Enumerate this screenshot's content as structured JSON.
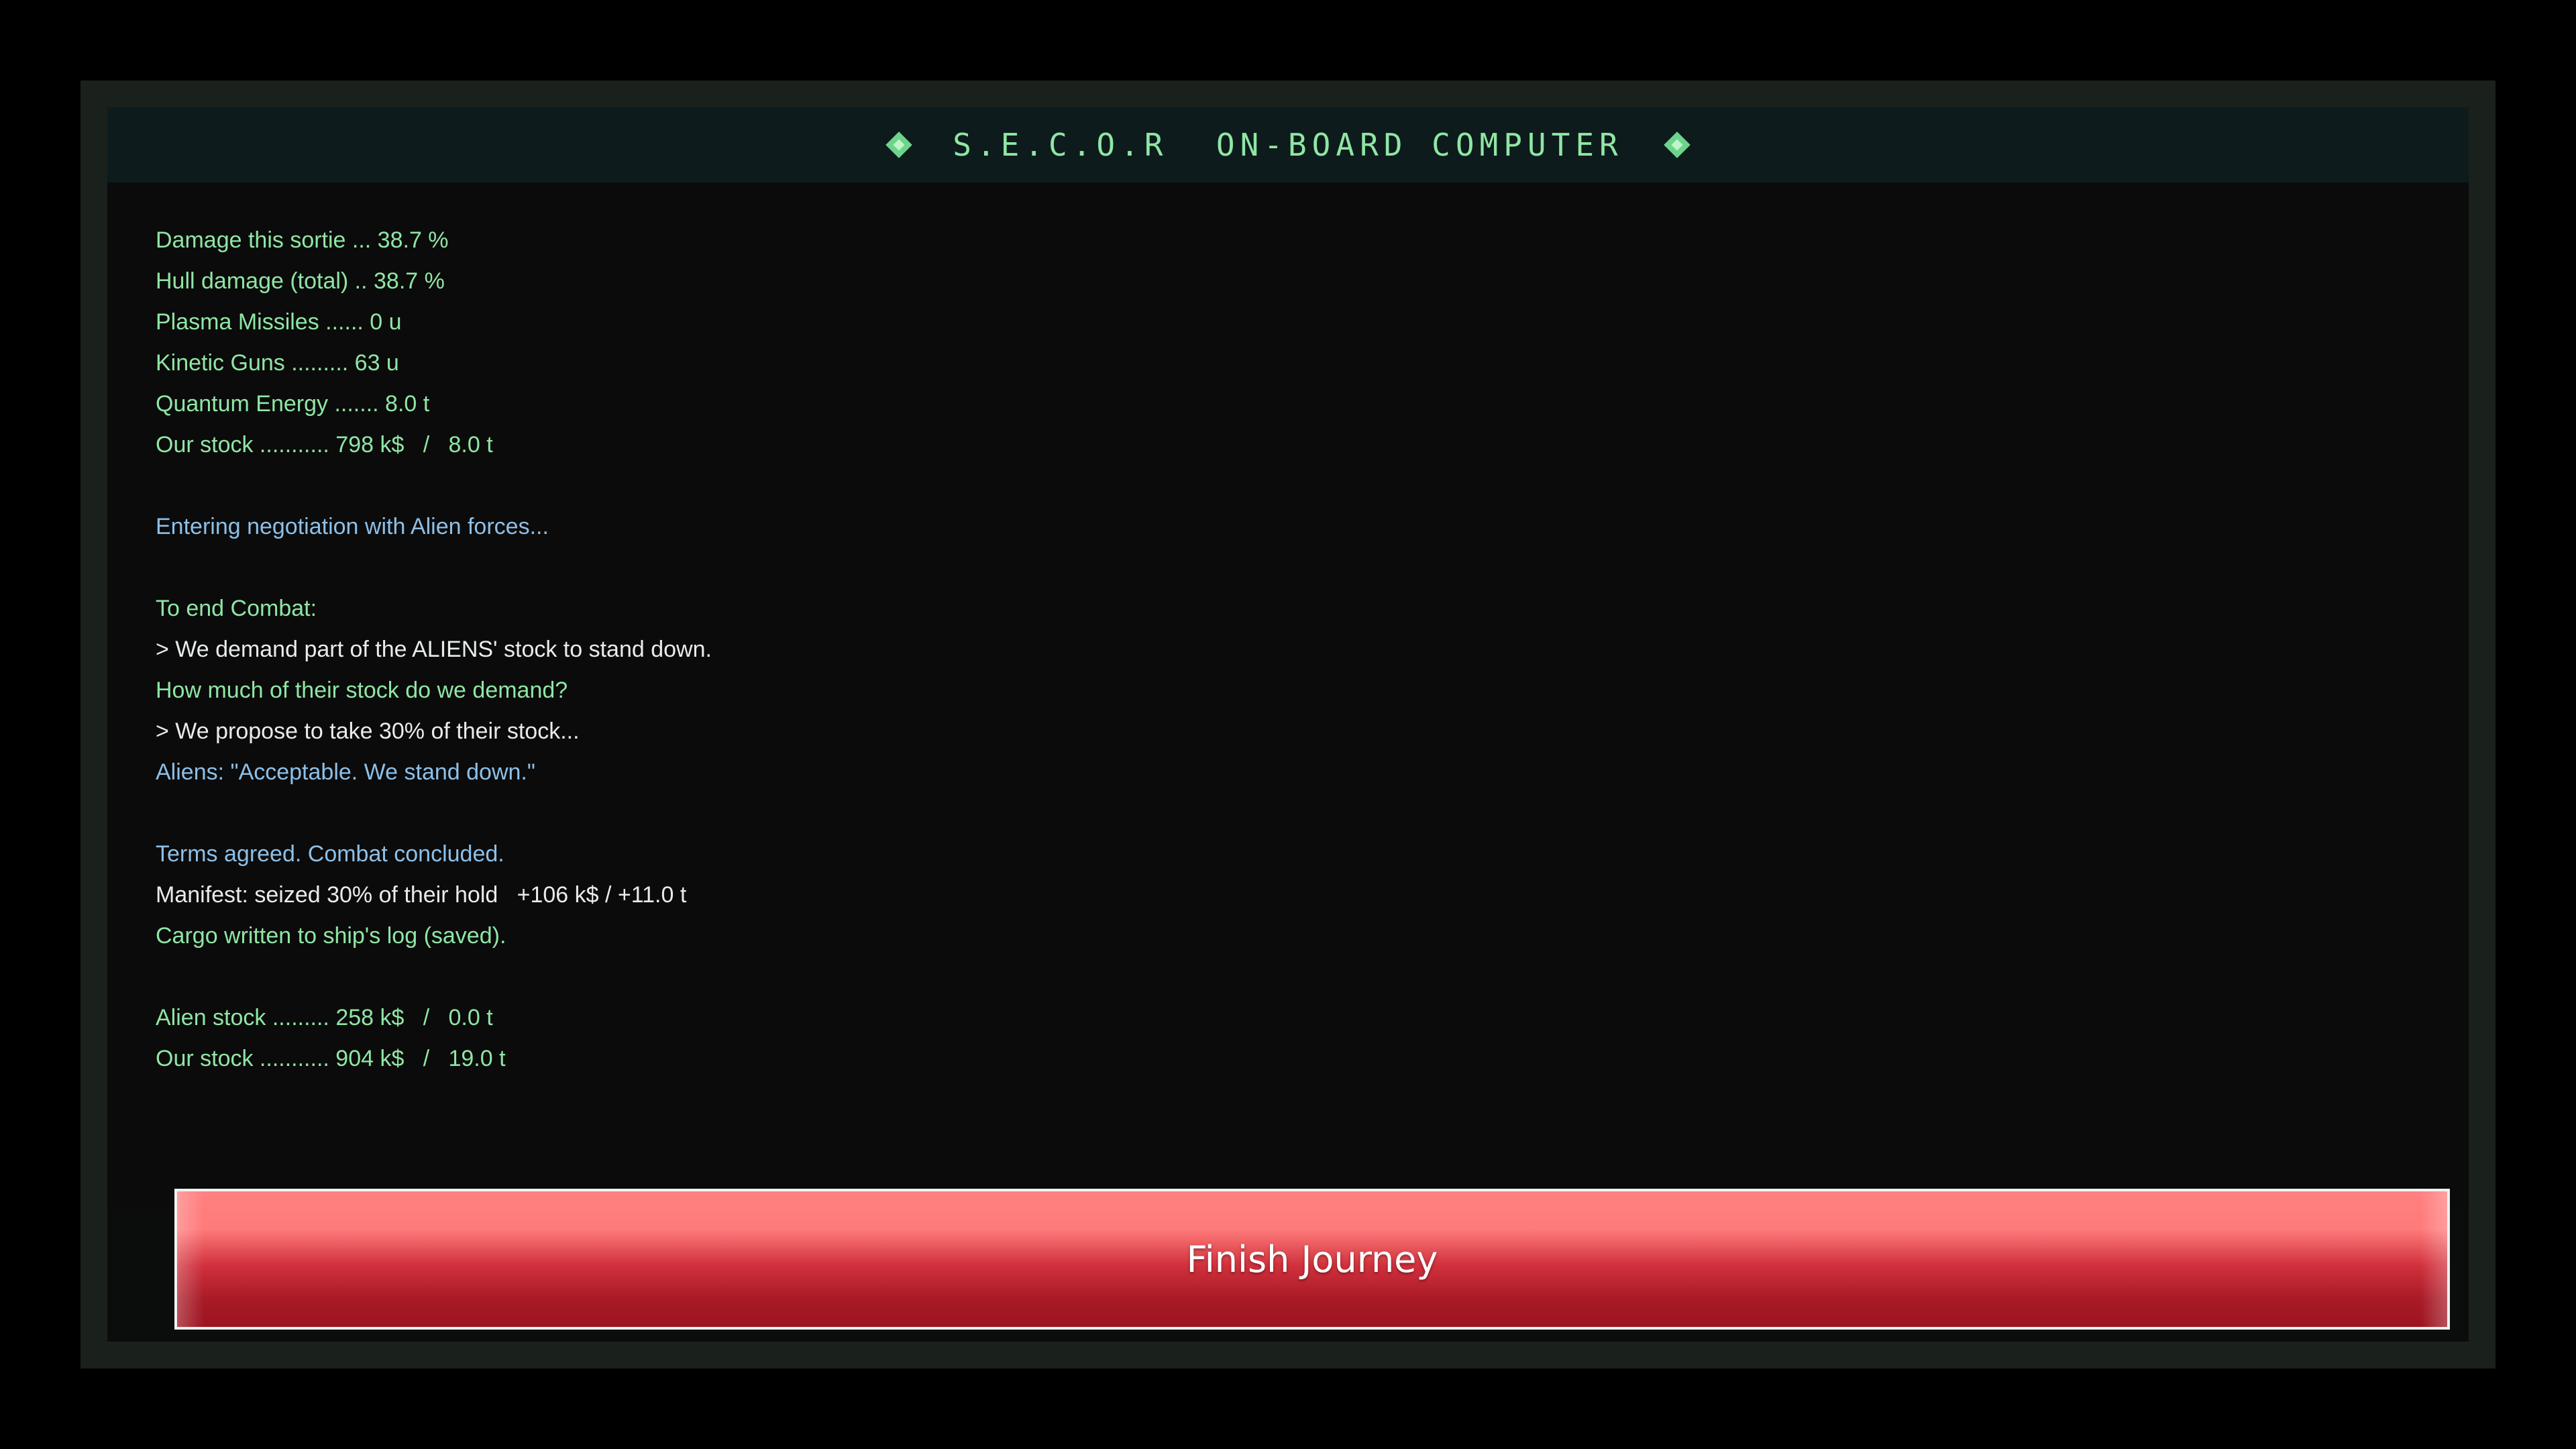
{
  "header": {
    "title": "S.E.C.O.R  ON-BOARD COMPUTER",
    "left_icon": "diamond-icon",
    "right_icon": "diamond-icon"
  },
  "log": {
    "lines": [
      {
        "text": "Damage this sortie ... 38.7 %",
        "color": "green"
      },
      {
        "text": "Hull damage (total) .. 38.7 %",
        "color": "green"
      },
      {
        "text": "Plasma Missiles ...... 0 u",
        "color": "green"
      },
      {
        "text": "Kinetic Guns ......... 63 u",
        "color": "green"
      },
      {
        "text": "Quantum Energy ....... 8.0 t",
        "color": "green"
      },
      {
        "text": "Our stock ........... 798 k$   /   8.0 t",
        "color": "green"
      },
      {
        "text": "",
        "color": "green"
      },
      {
        "text": "Entering negotiation with Alien forces...",
        "color": "blue"
      },
      {
        "text": "",
        "color": "green"
      },
      {
        "text": "To end Combat:",
        "color": "green"
      },
      {
        "text": "> We demand part of the ALIENS' stock to stand down.",
        "color": "white"
      },
      {
        "text": "How much of their stock do we demand?",
        "color": "green"
      },
      {
        "text": "> We propose to take 30% of their stock...",
        "color": "white"
      },
      {
        "text": "Aliens: \"Acceptable. We stand down.\"",
        "color": "blue"
      },
      {
        "text": "",
        "color": "green"
      },
      {
        "text": "Terms agreed. Combat concluded.",
        "color": "blue"
      },
      {
        "text": "Manifest: seized 30% of their hold   +106 k$ / +11.0 t",
        "color": "white"
      },
      {
        "text": "Cargo written to ship's log (saved).",
        "color": "green"
      },
      {
        "text": "",
        "color": "green"
      },
      {
        "text": "Alien stock ......... 258 k$   /   0.0 t",
        "color": "green"
      },
      {
        "text": "Our stock ........... 904 k$   /   19.0 t",
        "color": "green"
      }
    ]
  },
  "actions": {
    "finish_label": "Finish Journey"
  },
  "colors": {
    "green": "#8fe6a4",
    "blue": "#8dc0e8",
    "white": "#e8ecea",
    "button_top": "#ff8080",
    "button_bottom": "#9c1420"
  }
}
